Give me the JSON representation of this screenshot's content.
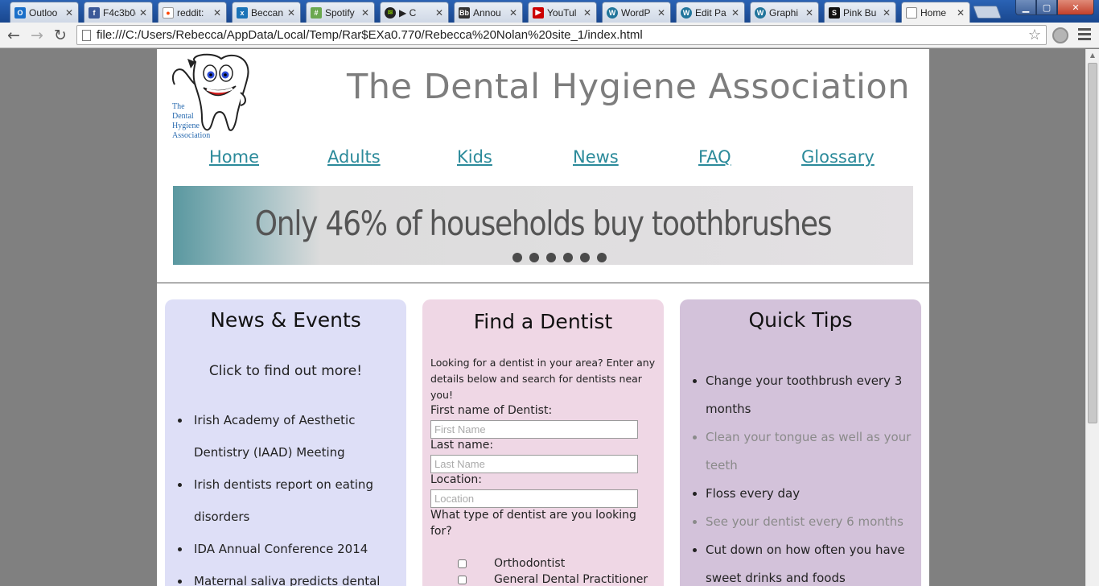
{
  "browser": {
    "tabs": [
      {
        "label": "Outloo",
        "icon": "outlook-icon",
        "color": "#1a6fc9"
      },
      {
        "label": "F4c3b0(",
        "icon": "facebook-icon",
        "color": "#3b5998"
      },
      {
        "label": "reddit:",
        "icon": "reddit-icon",
        "color": "#ff4500"
      },
      {
        "label": "Beccan",
        "icon": "beccan-icon",
        "color": "#1a73b8"
      },
      {
        "label": "Spotify",
        "icon": "spotify-web-icon",
        "color": "#6aa84f"
      },
      {
        "label": "▶ C",
        "icon": "spotify-icon",
        "color": "#222222"
      },
      {
        "label": "Annou",
        "icon": "blackboard-icon",
        "color": "#333333"
      },
      {
        "label": "YouTul",
        "icon": "youtube-icon",
        "color": "#cc0000"
      },
      {
        "label": "WordP",
        "icon": "wordpress-icon",
        "color": "#21759b"
      },
      {
        "label": "Edit Pa",
        "icon": "wordpress-icon",
        "color": "#21759b"
      },
      {
        "label": "Graphi",
        "icon": "wordpress-icon",
        "color": "#21759b"
      },
      {
        "label": "Pink Bu",
        "icon": "squarespace-icon",
        "color": "#111111"
      },
      {
        "label": "Home",
        "icon": "page-icon",
        "color": "#ffffff"
      }
    ],
    "url": "file:///C:/Users/Rebecca/AppData/Local/Temp/Rar$EXa0.770/Rebecca%20Nolan%20site_1/index.html"
  },
  "header": {
    "title": "The Dental Hygiene Association",
    "logo_text": [
      "The",
      "Dental",
      "Hygiene",
      "Association"
    ]
  },
  "nav": [
    "Home",
    "Adults",
    "Kids",
    "News",
    "FAQ",
    "Glossary"
  ],
  "banner": {
    "text": "Only 46% of households buy toothbrushes",
    "slide_count": 6
  },
  "news": {
    "title": "News & Events",
    "subtitle": "Click to find out more!",
    "items": [
      "Irish Academy of Aesthetic Dentistry (IAAD) Meeting",
      "Irish dentists report on eating disorders",
      "IDA Annual Conference 2014",
      "Maternal saliva predicts dental"
    ]
  },
  "find": {
    "title": "Find a Dentist",
    "intro": "Looking for a dentist in your area? Enter any details below and search for dentists near you!",
    "first_label": "First name of Dentist:",
    "first_placeholder": "First Name",
    "last_label": "Last name:",
    "last_placeholder": "Last Name",
    "location_label": "Location:",
    "location_placeholder": "Location",
    "type_question": "What type of dentist are you looking for?",
    "types": [
      "Orthodontist",
      "General Dental Practitioner"
    ]
  },
  "tips": {
    "title": "Quick Tips",
    "items": [
      "Change your toothbrush every 3 months",
      "Clean your tongue as well as your teeth",
      "Floss every day",
      "See your dentist every 6 months",
      "Cut down on how often you have sweet drinks and foods"
    ]
  }
}
